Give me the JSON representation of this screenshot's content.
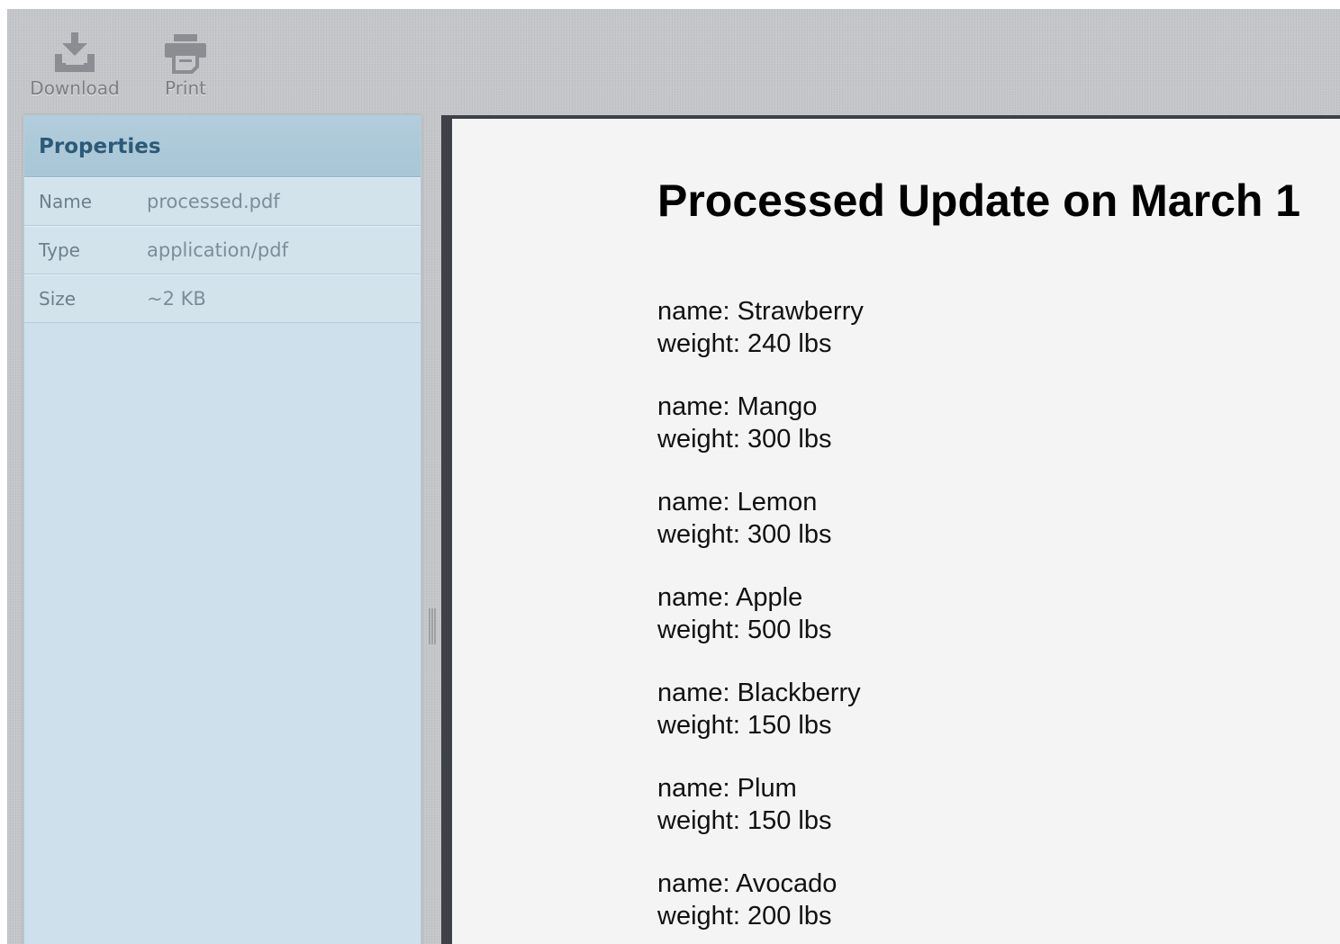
{
  "toolbar": {
    "download_label": "Download",
    "print_label": "Print"
  },
  "properties": {
    "title": "Properties",
    "rows": [
      {
        "key": "Name",
        "value": "processed.pdf"
      },
      {
        "key": "Type",
        "value": "application/pdf"
      },
      {
        "key": "Size",
        "value": "~2 KB"
      }
    ]
  },
  "document": {
    "title": "Processed Update on March 1",
    "entries": [
      {
        "name": "name: Strawberry",
        "weight": "weight: 240 lbs"
      },
      {
        "name": "name: Mango",
        "weight": "weight: 300 lbs"
      },
      {
        "name": "name: Lemon",
        "weight": "weight: 300 lbs"
      },
      {
        "name": "name: Apple",
        "weight": "weight: 500 lbs"
      },
      {
        "name": "name: Blackberry",
        "weight": "weight: 150 lbs"
      },
      {
        "name": "name: Plum",
        "weight": "weight: 150 lbs"
      },
      {
        "name": "name: Avocado",
        "weight": "weight: 200 lbs"
      }
    ]
  },
  "colors": {
    "panel": "#cde0eb",
    "panel_title": "#2c5a77",
    "toolbar_bg": "#c4c6ca",
    "viewer_frame": "#3e4147",
    "page": "#f4f4f4"
  }
}
